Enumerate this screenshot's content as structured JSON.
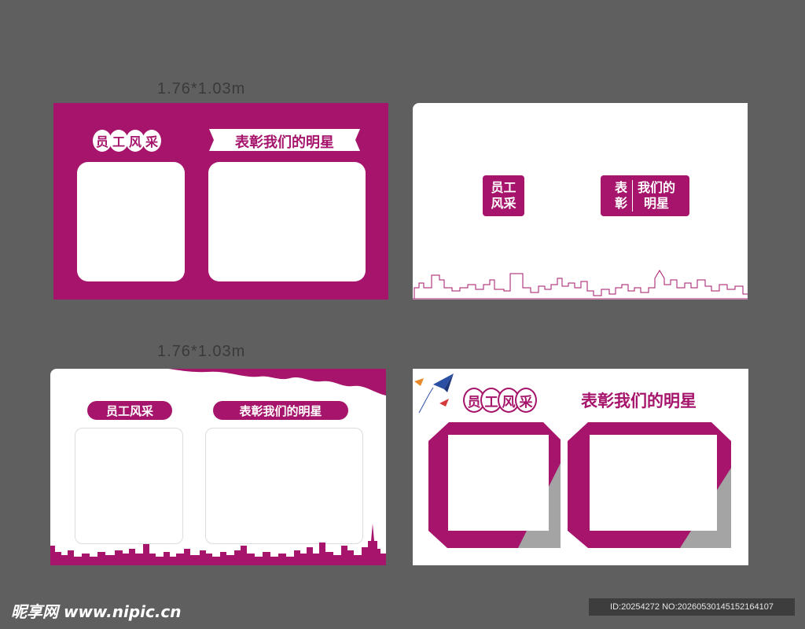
{
  "dimension_label_top": "1.76*1.03m",
  "dimension_label_bottom": "1.76*1.03m",
  "texts": {
    "staff_style": "员工风采",
    "praise_stars": "表彰我们的明星",
    "staff_tag_line1": "员工",
    "staff_tag_line2": "风采",
    "praise_tag_left_1": "表",
    "praise_tag_left_2": "彰",
    "praise_tag_right_1": "我们的",
    "praise_tag_right_2": "明星"
  },
  "bubble_chars": [
    "员",
    "工",
    "风",
    "采"
  ],
  "footer": {
    "logo": "昵享网 www.nipic.cn",
    "id_text": "ID:20254272 NO:20260530145152164107"
  },
  "colors": {
    "primary": "#a6156b",
    "background": "#5f5f5f",
    "board": "#ffffff",
    "accent_gray": "#a4a4a4"
  }
}
